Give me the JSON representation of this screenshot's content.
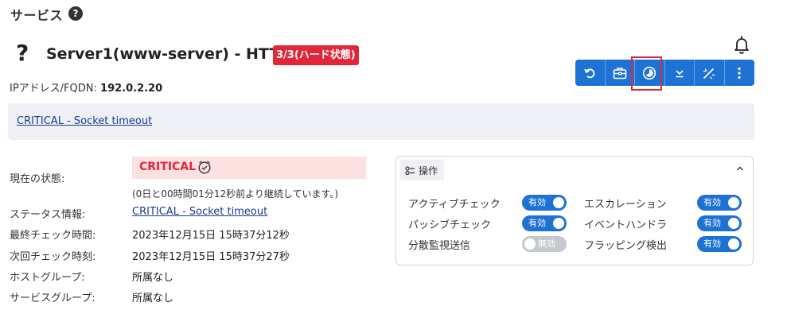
{
  "header": {
    "title": "サービス",
    "help_icon": "?"
  },
  "service": {
    "status_icon": "?",
    "name": "Server1(www-server) - HTTP",
    "state_badge": "3/3(ハード状態)",
    "ip_label": "IPアドレス/FQDN:",
    "ip_value": "192.0.2.20"
  },
  "toolbar": {
    "buttons": [
      {
        "name": "reschedule-icon"
      },
      {
        "name": "briefcase-icon"
      },
      {
        "name": "pie-chart-icon"
      },
      {
        "name": "download-icon"
      },
      {
        "name": "wand-icon"
      },
      {
        "name": "more-vert-icon"
      }
    ]
  },
  "output": {
    "text": "CRITICAL - Socket timeout"
  },
  "info": {
    "current_state_label": "現在の状態:",
    "current_state_value": "CRITICAL",
    "duration": "(0日と00時間01分12秒前より継続しています。)",
    "status_info_label": "ステータス情報:",
    "status_info_value": "CRITICAL - Socket timeout",
    "last_check_label": "最終チェック時間:",
    "last_check_value": "2023年12月15日 15時37分12秒",
    "next_check_label": "次回チェック時刻:",
    "next_check_value": "2023年12月15日 15時37分27秒",
    "host_group_label": "ホストグループ:",
    "host_group_value": "所属なし",
    "service_group_label": "サービスグループ:",
    "service_group_value": "所属なし"
  },
  "operations": {
    "tab_label": "操作",
    "items": [
      {
        "label": "アクティブチェック",
        "state": "有効"
      },
      {
        "label": "エスカレーション",
        "state": "有効"
      },
      {
        "label": "パッシブチェック",
        "state": "有効"
      },
      {
        "label": "イベントハンドラ",
        "state": "有効"
      },
      {
        "label": "分散監視送信",
        "state": "無効"
      },
      {
        "label": "フラッピング検出",
        "state": "有効"
      }
    ]
  },
  "colors": {
    "primary": "#1d72d4",
    "critical": "#e2263a",
    "critical_bg": "#fde0e0"
  }
}
